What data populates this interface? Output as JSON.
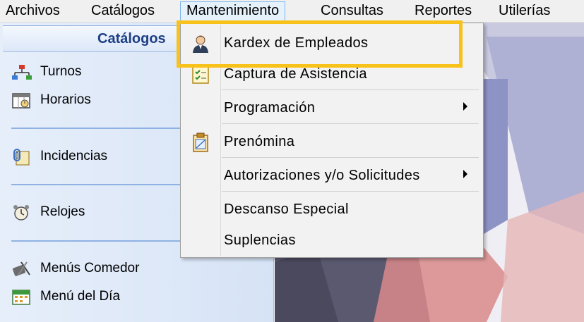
{
  "menubar": {
    "items": [
      "Archivos",
      "Catálogos",
      "Mantenimiento",
      "Consultas",
      "Reportes",
      "Utilerías"
    ]
  },
  "left_panel": {
    "title": "Catálogos",
    "items": [
      {
        "label": "Turnos",
        "icon": "org-chart-icon"
      },
      {
        "label": "Horarios",
        "icon": "calendar-clock-icon"
      },
      {
        "label": "Incidencias",
        "icon": "paperclip-document-icon"
      },
      {
        "label": "Relojes",
        "icon": "alarm-clock-icon"
      },
      {
        "label": "Menús Comedor",
        "icon": "utensils-icon"
      },
      {
        "label": "Menú del Día",
        "icon": "calendar-icon"
      }
    ]
  },
  "dropdown": {
    "items": [
      {
        "label": "Kardex de Empleados",
        "icon": "employee-icon"
      },
      {
        "label": "Captura de Asistencia",
        "icon": "checklist-icon"
      },
      {
        "label": "Programación",
        "icon": ""
      },
      {
        "label": "Prenómina",
        "icon": "clipboard-icon"
      },
      {
        "label": "Autorizaciones y/o Solicitudes",
        "icon": ""
      },
      {
        "label": "Descanso Especial",
        "icon": ""
      },
      {
        "label": "Suplencias",
        "icon": ""
      }
    ]
  },
  "colors": {
    "highlight": "#f9c21b",
    "panel_title_text": "#1d3f86",
    "menu_active_bg": "#e5f1fb"
  }
}
